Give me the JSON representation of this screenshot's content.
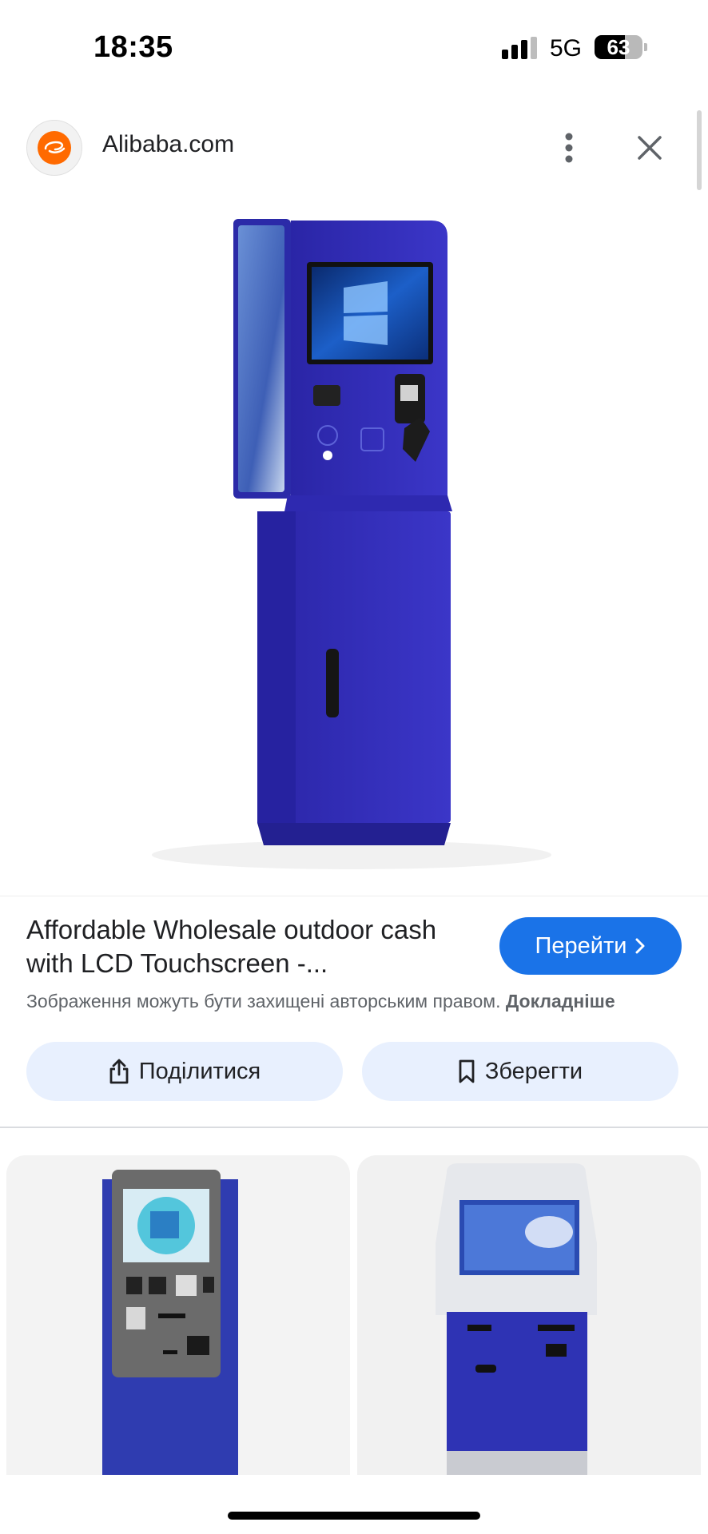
{
  "status_bar": {
    "time": "18:35",
    "network": "5G",
    "battery_level": "63",
    "battery_fraction": 0.63
  },
  "header": {
    "site_name": "Alibaba.com",
    "icons": {
      "more": "more-vert-icon",
      "close": "close-icon"
    }
  },
  "result": {
    "title": "Affordable Wholesale outdoor cash with LCD Touchscreen -...",
    "visit_label": "Перейти",
    "copyright_text": "Зображення можуть бути захищені авторським правом.",
    "learn_more": "Докладніше"
  },
  "actions": {
    "share_label": "Поділитися",
    "save_label": "Зберегти"
  },
  "colors": {
    "accent": "#1a73e8",
    "chip_bg": "#e8f0fe",
    "kiosk_blue": "#2f2fb8",
    "brand_orange": "#ff6a00"
  }
}
